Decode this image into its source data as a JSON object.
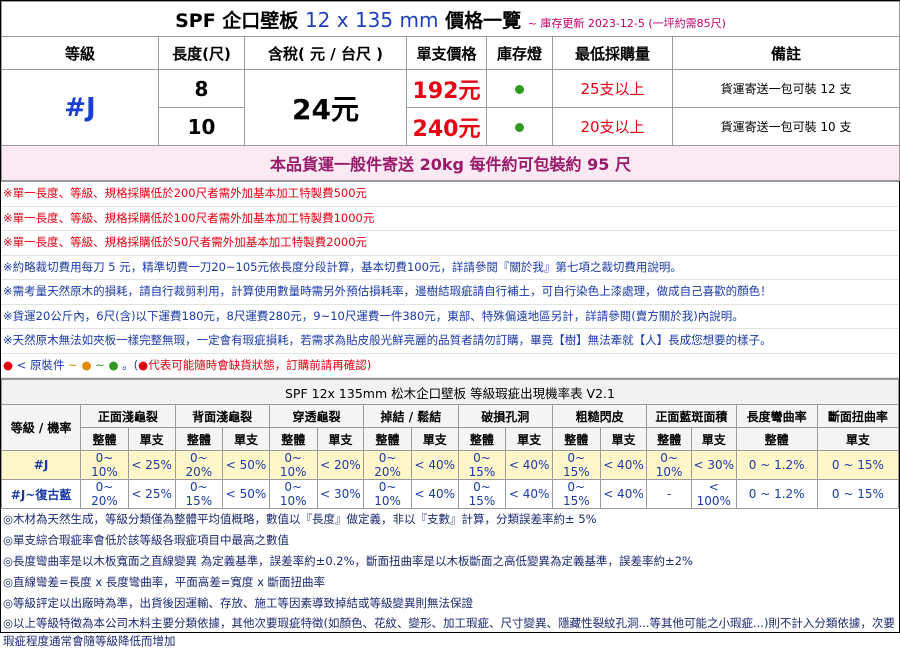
{
  "header": {
    "product": "SPF 企口壁板",
    "size": "12 x 135 mm",
    "title_suffix": "價格一覽",
    "updated": "~ 庫存更新 2023-12-5 (一坪約需85尺)"
  },
  "columns": [
    "等級",
    "長度(尺)",
    "含稅( 元 / 台尺 )",
    "單支價格",
    "庫存燈",
    "最低採購量",
    "備註"
  ],
  "grade": "#J",
  "tax_price": "24元",
  "rows": [
    {
      "length": "8",
      "price": "192元",
      "min_qty": "25支以上",
      "remark": "貨運寄送一包可裝 12 支"
    },
    {
      "length": "10",
      "price": "240元",
      "min_qty": "20支以上",
      "remark": "貨運寄送一包可裝 10 支"
    }
  ],
  "shipping": "本品貨運一般件寄送 20kg 每件約可包裝約 95 尺",
  "notes": [
    "※單一長度、等級、規格採購低於200尺者需外加基本加工特製費500元",
    "※單一長度、等級、規格採購低於100尺者需外加基本加工特製費1000元",
    "※單一長度、等級、規格採購低於50尺者需外加基本加工特製費2000元",
    "※約略裁切費用每刀 5 元，精準切費一刀20~105元依長度分段計算，基本切費100元，詳請參閱『關於我』第七項之裁切費用說明。",
    "※需考量天然原木的損耗，請自行裁剪利用，計算使用數量時需另外預估損耗率，邊樹結瑕疵請自行補土，可自行染色上漆處理，做成自己喜歡的顏色！",
    "※貨運20公斤內，6尺(含)以下運費180元，8尺運費280元，9~10尺運費一件380元，東部、特殊偏遠地區另計，詳請參閱(賣方關於我)內說明。",
    "※天然原木無法如夾板一樣完整無瑕，一定會有瑕疵損耗，若需求為貼皮般光鮮亮麗的品質者請勿訂購，畢竟【樹】無法牽就【人】長成您想要的樣子。"
  ],
  "legend": {
    "intro": "< 原裝件",
    "tilde": "~",
    "notice_open": "。(",
    "notice": "代表可能隨時會缺貨狀態，訂購前請再確認)",
    "dot_colors": [
      "#e60012",
      "#e08a00",
      "#2e9a1e"
    ]
  },
  "defects": {
    "title": "SPF 12x 135mm 松木企口壁板 等級瑕疵出現機率表 V2.1",
    "corner_label": "等級 / 機率",
    "groups": [
      "正面淺龜裂",
      "背面淺龜裂",
      "穿透龜裂",
      "掉結 / 鬆結",
      "破損孔洞",
      "粗糙閃皮",
      "正面藍斑面積",
      "長度彎曲率",
      "斷面扭曲率"
    ],
    "sub_whole": "整體",
    "sub_single": "單支",
    "rows": [
      {
        "label": "#J",
        "cells": [
          "0~ 10%",
          "< 25%",
          "0~ 20%",
          "< 50%",
          "0~ 10%",
          "< 20%",
          "0~ 20%",
          "< 40%",
          "0~ 15%",
          "< 40%",
          "0~ 15%",
          "< 40%",
          "0~ 10%",
          "< 30%",
          "0 ~ 1.2%",
          "0 ~ 15%"
        ]
      },
      {
        "label": "#J~復古藍",
        "cells": [
          "0~ 20%",
          "< 25%",
          "0~ 15%",
          "< 50%",
          "0~ 10%",
          "< 30%",
          "0~ 10%",
          "< 40%",
          "0~ 15%",
          "< 40%",
          "0~ 15%",
          "< 40%",
          "-",
          "< 100%",
          "0 ~ 1.2%",
          "0 ~ 15%"
        ]
      }
    ],
    "footnotes": [
      "◎木材為天然生成，等級分類僅為整體平均值概略，數值以『長度』做定義，非以『支數』計算，分類誤差率約± 5%",
      "◎單支綜合瑕疵率會低於該等級各瑕疵項目中最高之數值",
      "◎長度彎曲率是以木板寬面之直線變異 為定義基準，誤差率約±0.2%，斷面扭曲率是以木板斷面之高低變異為定義基準，誤差率約±2%",
      "◎直線彎差=長度 x 長度彎曲率，平面高差=寬度 x 斷面扭曲率",
      "◎等級評定以出廠時為準，出貨後因運輸、存放、施工等因素導致掉結或等級變異則無法保證",
      "◎以上等級特徵為本公司木料主要分類依據，其他次要瑕疵特徵(如顏色、花紋、變形、加工瑕疵、尺寸變異、隱藏性裂紋孔洞...等其他可能之小瑕疵...)則不計入分類依據，次要瑕疵程度通常會隨等級降低而增加"
    ]
  }
}
